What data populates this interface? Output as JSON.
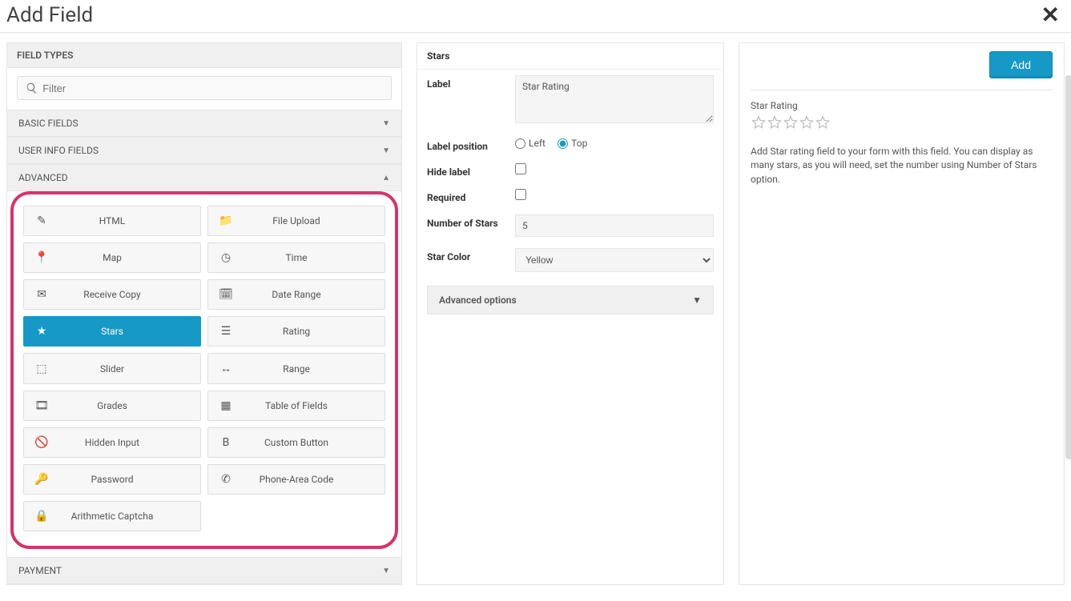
{
  "modal": {
    "title": "Add Field"
  },
  "left": {
    "section_title": "FIELD TYPES",
    "filter_placeholder": "Filter",
    "accordions": {
      "basic": "BASIC FIELDS",
      "user": "USER INFO FIELDS",
      "advanced": "ADVANCED",
      "payment": "PAYMENT"
    },
    "items": [
      {
        "label": "HTML",
        "icon": "pencil"
      },
      {
        "label": "File Upload",
        "icon": "folder"
      },
      {
        "label": "Map",
        "icon": "pin"
      },
      {
        "label": "Time",
        "icon": "clock"
      },
      {
        "label": "Receive Copy",
        "icon": "mail"
      },
      {
        "label": "Date Range",
        "icon": "calendar"
      },
      {
        "label": "Stars",
        "icon": "star",
        "active": true
      },
      {
        "label": "Rating",
        "icon": "bars"
      },
      {
        "label": "Slider",
        "icon": "slider"
      },
      {
        "label": "Range",
        "icon": "range"
      },
      {
        "label": "Grades",
        "icon": "film"
      },
      {
        "label": "Table of Fields",
        "icon": "grid"
      },
      {
        "label": "Hidden Input",
        "icon": "eyehide"
      },
      {
        "label": "Custom Button",
        "icon": "bold"
      },
      {
        "label": "Password",
        "icon": "key"
      },
      {
        "label": "Phone-Area Code",
        "icon": "phone"
      },
      {
        "label": "Arithmetic Captcha",
        "icon": "lock"
      }
    ]
  },
  "mid": {
    "title": "Stars",
    "label_label": "Label",
    "label_value": "Star Rating",
    "labelpos_label": "Label position",
    "labelpos_left": "Left",
    "labelpos_top": "Top",
    "labelpos_selected": "top",
    "hide_label": "Hide label",
    "required_label": "Required",
    "numstars_label": "Number of Stars",
    "numstars_value": "5",
    "color_label": "Star Color",
    "color_value": "Yellow",
    "adv_options": "Advanced options"
  },
  "right": {
    "add_btn": "Add",
    "preview_label": "Star Rating",
    "star_count": 5,
    "description": "Add Star rating field to your form with this field. You can display as many stars, as you will need, set the number using Number of Stars option."
  }
}
